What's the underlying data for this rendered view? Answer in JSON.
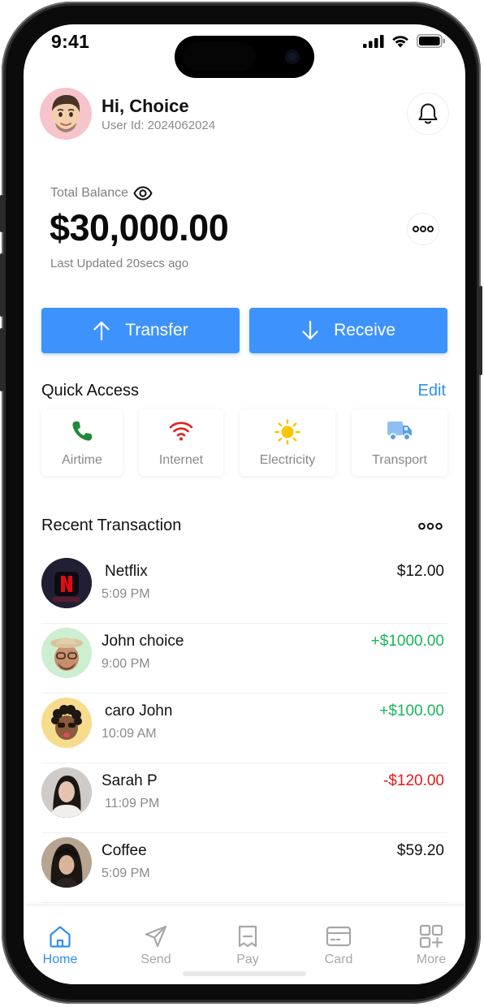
{
  "status_bar": {
    "time": "9:41"
  },
  "header": {
    "greeting": "Hi, Choice",
    "user_id": "User Id: 2024062024"
  },
  "balance": {
    "label": "Total Balance",
    "amount": "$30,000.00",
    "updated": "Last Updated 20secs ago"
  },
  "actions": {
    "transfer": "Transfer",
    "receive": "Receive"
  },
  "quick_access": {
    "title": "Quick Access",
    "edit": "Edit",
    "items": [
      {
        "label": "Airtime",
        "icon": "phone-icon",
        "color": "#1f8a3a"
      },
      {
        "label": "Internet",
        "icon": "wifi-icon",
        "color": "#e02020"
      },
      {
        "label": "Electricity",
        "icon": "sun-icon",
        "color": "#f7c600"
      },
      {
        "label": "Transport",
        "icon": "truck-icon",
        "color": "#6aa8ef"
      }
    ]
  },
  "recent": {
    "title": "Recent Transaction",
    "items": [
      {
        "name": "Netflix",
        "time": "5:09 PM",
        "amount": "$12.00",
        "kind": "neutral"
      },
      {
        "name": "John choice",
        "time": "9:00 PM",
        "amount": "+$1000.00",
        "kind": "positive"
      },
      {
        "name": "caro John",
        "time": "10:09 AM",
        "amount": "+$100.00",
        "kind": "positive"
      },
      {
        "name": "Sarah P",
        "time": "11:09 PM",
        "amount": "-$120.00",
        "kind": "negative"
      },
      {
        "name": "Coffee",
        "time": "5:09 PM",
        "amount": "$59.20",
        "kind": "neutral"
      }
    ]
  },
  "nav": [
    {
      "label": "Home",
      "icon": "home-icon",
      "active": true
    },
    {
      "label": "Send",
      "icon": "send-icon",
      "active": false
    },
    {
      "label": "Pay",
      "icon": "receipt-icon",
      "active": false
    },
    {
      "label": "Card",
      "icon": "card-icon",
      "active": false
    },
    {
      "label": "More",
      "icon": "grid-plus-icon",
      "active": false
    }
  ],
  "colors": {
    "accent": "#3d93fb",
    "positive": "#17b65a",
    "negative": "#e21b1b"
  }
}
